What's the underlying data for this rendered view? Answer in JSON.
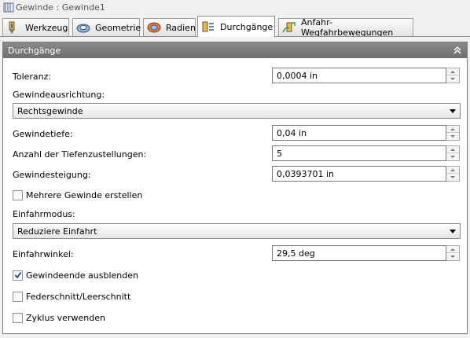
{
  "window": {
    "title": "Gewinde : Gewinde1"
  },
  "tabs": [
    {
      "label": "Werkzeug",
      "icon": "tool-icon",
      "active": false
    },
    {
      "label": "Geometrie",
      "icon": "geometry-icon",
      "active": false
    },
    {
      "label": "Radien",
      "icon": "radii-icon",
      "active": false
    },
    {
      "label": "Durchgänge",
      "icon": "passes-icon",
      "active": true
    },
    {
      "label": "Anfahr-Wegfahrbewegungen",
      "icon": "linking-icon",
      "active": false
    }
  ],
  "panel": {
    "title": "Durchgänge",
    "collapse_icon": "double-chevron-up-icon",
    "toleranz": {
      "label": "Toleranz:",
      "value": "0,0004 in"
    },
    "gewindeausrichtung": {
      "label": "Gewindeausrichtung:",
      "value": "Rechtsgewinde"
    },
    "gewindetiefe": {
      "label": "Gewindetiefe:",
      "value": "0,04 in"
    },
    "tiefenzustellungen": {
      "label": "Anzahl der Tiefenzustellungen:",
      "value": "5"
    },
    "gewindesteigung": {
      "label": "Gewindesteigung:",
      "value": "0,0393701 in"
    },
    "mehrere_gewinde": {
      "label": "Mehrere Gewinde erstellen",
      "checked": false
    },
    "einfahrmodus": {
      "label": "Einfahrmodus:",
      "value": "Reduziere Einfahrt"
    },
    "einfahrwinkel": {
      "label": "Einfahrwinkel:",
      "value": "29,5 deg"
    },
    "gewindeende": {
      "label": "Gewindeende ausblenden",
      "checked": true
    },
    "federschnitt": {
      "label": "Federschnitt/Leerschnitt",
      "checked": false
    },
    "zyklus": {
      "label": "Zyklus verwenden",
      "checked": false
    }
  },
  "colors": {
    "header_bg": "#7a7a7a",
    "panel_bg": "#ffffff",
    "window_bg": "#f0f0f0"
  }
}
